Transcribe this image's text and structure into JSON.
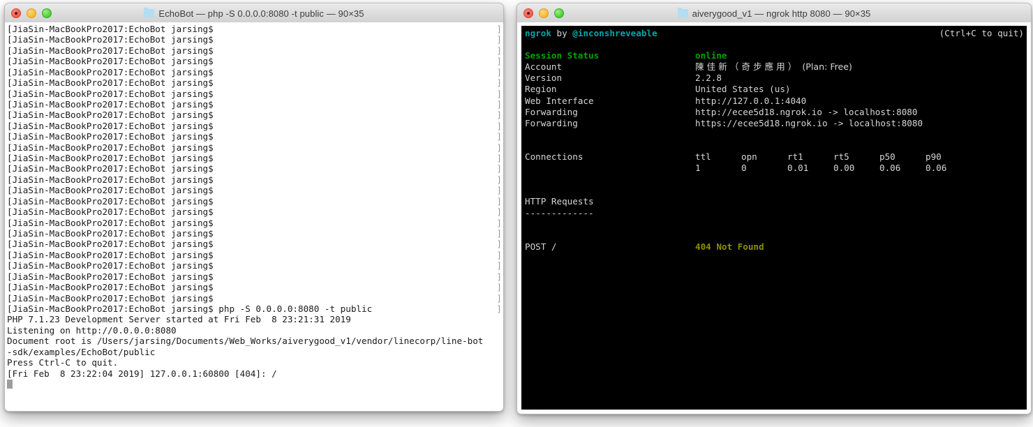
{
  "windows": {
    "left": {
      "title": "EchoBot — php -S 0.0.0.0:8080 -t public — 90×35",
      "folder_icon": "folder-icon",
      "traffic": {
        "close": "close",
        "minimize": "minimize",
        "zoom": "zoom"
      },
      "prompt": "[JiaSin-MacBookPro2017:EchoBot jarsing$",
      "prompt_repeat_count": 26,
      "wrap_marker": "]",
      "command_line": "[JiaSin-MacBookPro2017:EchoBot jarsing$ php -S 0.0.0.0:8080 -t public",
      "output_lines": [
        "PHP 7.1.23 Development Server started at Fri Feb  8 23:21:31 2019",
        "Listening on http://0.0.0.0:8080",
        "Document root is /Users/jarsing/Documents/Web_Works/aiverygood_v1/vendor/linecorp/line-bot",
        "-sdk/examples/EchoBot/public",
        "Press Ctrl-C to quit.",
        "[Fri Feb  8 23:22:04 2019] 127.0.0.1:60800 [404]: /"
      ]
    },
    "right": {
      "title": "aiverygood_v1 — ngrok http 8080 — 90×35",
      "folder_icon": "folder-icon",
      "traffic": {
        "close": "close",
        "minimize": "minimize",
        "zoom": "zoom"
      },
      "header": {
        "app": "ngrok",
        "by": " by ",
        "author": "@inconshreveable",
        "quit_hint": "(Ctrl+C to quit)"
      },
      "status_rows": [
        {
          "label": "Session Status",
          "value": "online",
          "color": "green"
        },
        {
          "label": "Account",
          "value": "陳 佳 新 （ 奇 步 應 用 ）  (Plan: Free)",
          "color": "white"
        },
        {
          "label": "Version",
          "value": "2.2.8",
          "color": "white"
        },
        {
          "label": "Region",
          "value": "United States (us)",
          "color": "white"
        },
        {
          "label": "Web Interface",
          "value": "http://127.0.0.1:4040",
          "color": "white"
        },
        {
          "label": "Forwarding",
          "value": "http://ecee5d18.ngrok.io -> localhost:8080",
          "color": "white"
        },
        {
          "label": "Forwarding",
          "value": "https://ecee5d18.ngrok.io -> localhost:8080",
          "color": "white"
        }
      ],
      "connections": {
        "label": "Connections",
        "headers": [
          "ttl",
          "opn",
          "rt1",
          "rt5",
          "p50",
          "p90"
        ],
        "values": [
          "1",
          "0",
          "0.01",
          "0.00",
          "0.06",
          "0.06"
        ]
      },
      "http_requests": {
        "label": "HTTP Requests",
        "underline": "-------------",
        "entries": [
          {
            "request": "POST /",
            "status": "404 Not Found",
            "color": "yellow"
          }
        ]
      }
    }
  },
  "colors": {
    "teal": "#00a7a7",
    "green": "#00a300",
    "yellow": "#8f8f00",
    "terminal_white": "#d6d6d6",
    "terminal_bg": "#000000",
    "light_terminal_bg": "#ffffff",
    "light_terminal_fg": "#1a1a1a"
  }
}
